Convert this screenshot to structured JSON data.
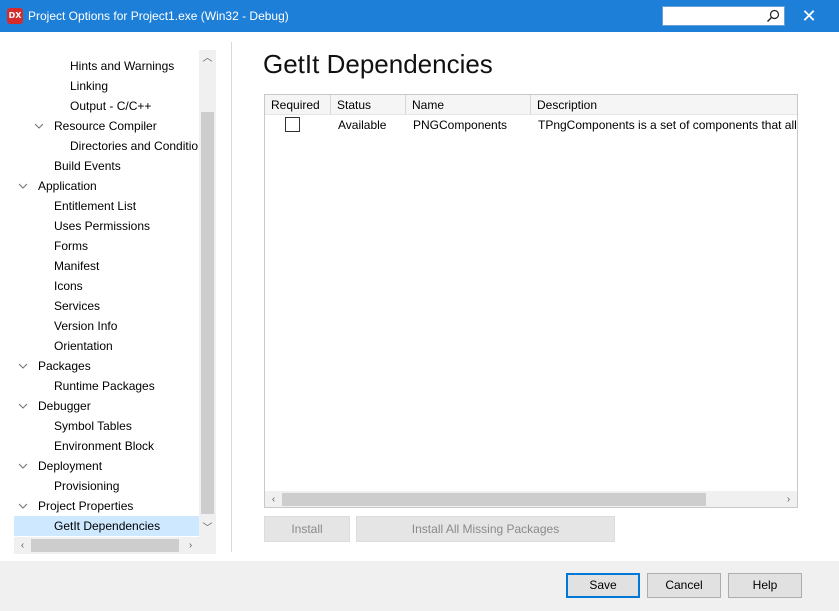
{
  "window": {
    "app_icon_text": "DX",
    "title": "Project Options for Project1.exe  (Win32 - Debug)",
    "search_placeholder": "",
    "close_glyph": "✕"
  },
  "tree": {
    "items": [
      {
        "label": "Hints and Warnings",
        "level": 3,
        "expandable": false
      },
      {
        "label": "Linking",
        "level": 3,
        "expandable": false
      },
      {
        "label": "Output - C/C++",
        "level": 3,
        "expandable": false
      },
      {
        "label": "Resource Compiler",
        "level": 2,
        "expandable": true
      },
      {
        "label": "Directories and Conditionals",
        "level": 3,
        "expandable": false
      },
      {
        "label": "Build Events",
        "level": 2,
        "expandable": false
      },
      {
        "label": "Application",
        "level": 1,
        "expandable": true
      },
      {
        "label": "Entitlement List",
        "level": 2,
        "expandable": false
      },
      {
        "label": "Uses Permissions",
        "level": 2,
        "expandable": false
      },
      {
        "label": "Forms",
        "level": 2,
        "expandable": false
      },
      {
        "label": "Manifest",
        "level": 2,
        "expandable": false
      },
      {
        "label": "Icons",
        "level": 2,
        "expandable": false
      },
      {
        "label": "Services",
        "level": 2,
        "expandable": false
      },
      {
        "label": "Version Info",
        "level": 2,
        "expandable": false
      },
      {
        "label": "Orientation",
        "level": 2,
        "expandable": false
      },
      {
        "label": "Packages",
        "level": 1,
        "expandable": true
      },
      {
        "label": "Runtime Packages",
        "level": 2,
        "expandable": false
      },
      {
        "label": "Debugger",
        "level": 1,
        "expandable": true
      },
      {
        "label": "Symbol Tables",
        "level": 2,
        "expandable": false
      },
      {
        "label": "Environment Block",
        "level": 2,
        "expandable": false
      },
      {
        "label": "Deployment",
        "level": 1,
        "expandable": true
      },
      {
        "label": "Provisioning",
        "level": 2,
        "expandable": false
      },
      {
        "label": "Project Properties",
        "level": 1,
        "expandable": true
      },
      {
        "label": "GetIt Dependencies",
        "level": 2,
        "expandable": false,
        "selected": true
      }
    ]
  },
  "main": {
    "title": "GetIt Dependencies",
    "columns": [
      "Required",
      "Status",
      "Name",
      "Description"
    ],
    "rows": [
      {
        "required": false,
        "status": "Available",
        "name": "PNGComponents",
        "description": "TPngComponents is a set of components that allows"
      }
    ],
    "install_label": "Install",
    "install_all_label": "Install All Missing Packages"
  },
  "footer": {
    "save_label": "Save",
    "cancel_label": "Cancel",
    "help_label": "Help"
  },
  "colors": {
    "titlebar": "#1e7fd8",
    "selection": "#cde8ff",
    "accent": "#0078d7"
  }
}
